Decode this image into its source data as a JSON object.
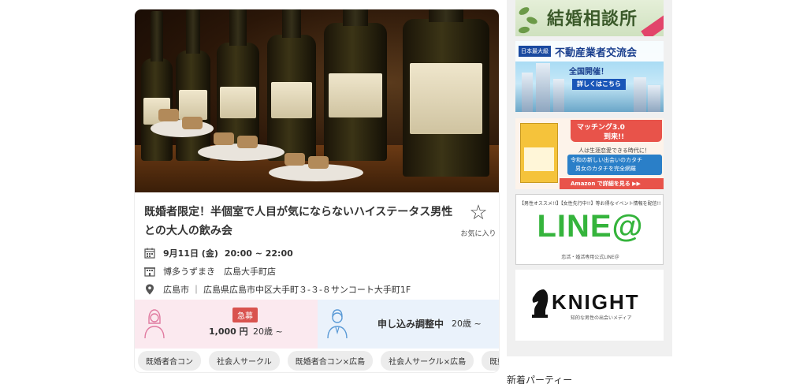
{
  "event": {
    "title": "既婚者限定！半個室で人目が気にならないハイステータス男性との大人の飲み会",
    "favorite_label": "お気に入り",
    "date": "9月11日 (金)",
    "time": "20:00 ~ 22:00",
    "venue": "博多うずまき　広島大手町店",
    "address": "広島市 ｜ 広島県広島市中区大手町３-３-８サンコート大手町1F",
    "female": {
      "badge": "急募",
      "price": "1,000 円",
      "age": "20歳 ~"
    },
    "male": {
      "status": "申し込み調整中",
      "age": "20歳 ~"
    },
    "tags": [
      "既婚者合コン",
      "社会人サークル",
      "既婚者合コン×広島",
      "社会人サークル×広島",
      "既婚者"
    ]
  },
  "sidebar": {
    "banner1": {
      "text": "結婚相談所"
    },
    "banner2": {
      "tag": "日本最大級",
      "title": "不動産業者交流会",
      "sub": "全国開催！",
      "button": "詳しくはこちら"
    },
    "banner3": {
      "head1": "マッチング3.0",
      "head2": "到来!!",
      "line1": "人は生涯恋愛できる時代に！",
      "box1": "令和の新しい出会いのカタチ",
      "box2": "男女のカタチを完全網羅",
      "foot": "Amazon で詳細を見る ▶▶"
    },
    "banner4": {
      "top": "【男性オススメ!!】【女性先行中!!】等お得なイベント情報を配信!!",
      "logo": "LINE@",
      "foot": "恋活・婚活専用公式LINE＠"
    },
    "banner5": {
      "logo": "KNIGHT",
      "sub": "知的な男性の出会いメディア"
    }
  },
  "footer": {
    "new_party": "新着パーティー"
  },
  "colors": {
    "accent_red": "#d9534f",
    "female_bg": "#fbe9ef",
    "male_bg": "#eaf2fb",
    "line_green": "#35b43c"
  }
}
